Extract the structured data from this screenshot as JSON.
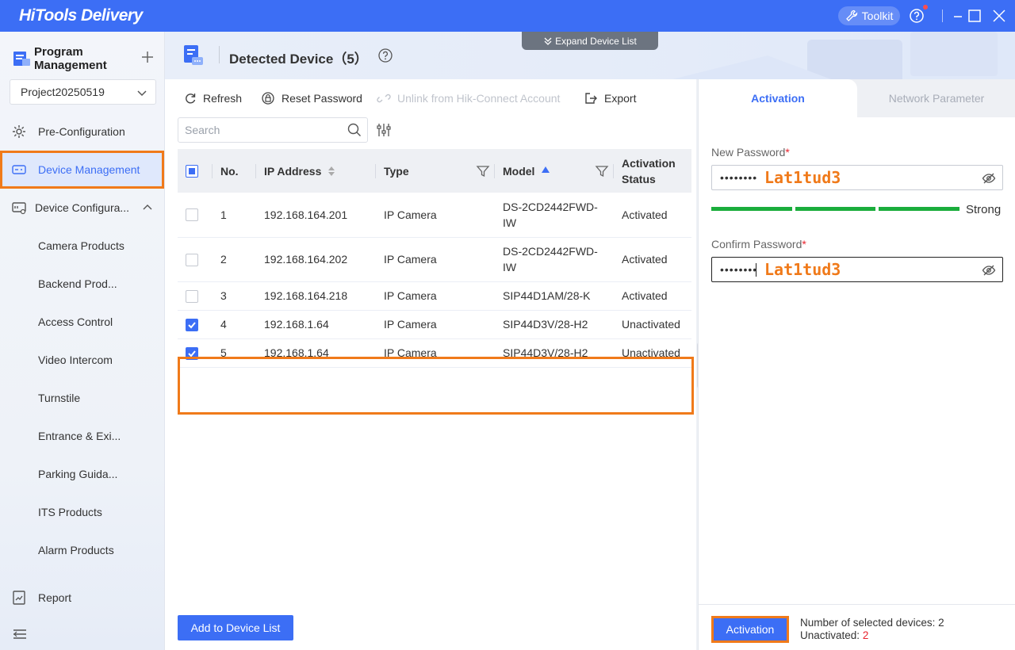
{
  "app": {
    "title": "HiTools Delivery",
    "toolkit_label": "Toolkit"
  },
  "sidebar": {
    "program_title": "Program Management",
    "project": "Project20250519",
    "items": [
      {
        "label": "Pre-Configuration",
        "icon": "gear-icon"
      },
      {
        "label": "Device Management",
        "icon": "device-icon"
      },
      {
        "label": "Device Configura...",
        "icon": "device-config-icon"
      },
      {
        "label": "Camera Products"
      },
      {
        "label": "Backend Prod..."
      },
      {
        "label": "Access Control"
      },
      {
        "label": "Video Intercom"
      },
      {
        "label": "Turnstile"
      },
      {
        "label": "Entrance & Exi..."
      },
      {
        "label": "Parking Guida..."
      },
      {
        "label": "ITS Products"
      },
      {
        "label": "Alarm Products"
      },
      {
        "label": "Report",
        "icon": "report-icon"
      }
    ]
  },
  "header": {
    "expand_label": "Expand Device List",
    "title": "Detected Device（5）"
  },
  "toolbar": {
    "refresh": "Refresh",
    "reset_password": "Reset Password",
    "unlink": "Unlink from Hik-Connect Account",
    "export": "Export",
    "search_placeholder": "Search"
  },
  "table": {
    "headers": {
      "no": "No.",
      "ip": "IP Address",
      "type": "Type",
      "model": "Model",
      "status_line1": "Activation",
      "status_line2": "Status"
    },
    "rows": [
      {
        "no": "1",
        "ip": "192.168.164.201",
        "type": "IP Camera",
        "model_l1": "DS-2CD2442FWD-",
        "model_l2": "IW",
        "status": "Activated",
        "checked": false
      },
      {
        "no": "2",
        "ip": "192.168.164.202",
        "type": "IP Camera",
        "model_l1": "DS-2CD2442FWD-",
        "model_l2": "IW",
        "status": "Activated",
        "checked": false
      },
      {
        "no": "3",
        "ip": "192.168.164.218",
        "type": "IP Camera",
        "model_l1": "SIP44D1AM/28-K",
        "model_l2": "",
        "status": "Activated",
        "checked": false
      },
      {
        "no": "4",
        "ip": "192.168.1.64",
        "type": "IP Camera",
        "model_l1": "SIP44D3V/28-H2",
        "model_l2": "",
        "status": "Unactivated",
        "checked": true
      },
      {
        "no": "5",
        "ip": "192.168.1.64",
        "type": "IP Camera",
        "model_l1": "SIP44D3V/28-H2",
        "model_l2": "",
        "status": "Unactivated",
        "checked": true
      }
    ]
  },
  "add_button": "Add to Device List",
  "activation": {
    "tab_activation": "Activation",
    "tab_network": "Network Parameter",
    "new_password_label": "New Password",
    "confirm_password_label": "Confirm Password",
    "required_mark": "*",
    "password_mask": "••••••••",
    "password_hint": "Lat1tud3",
    "strength": "Strong",
    "button": "Activation",
    "selected_label": "Number of selected devices: 2",
    "unactivated_label": "Unactivated:",
    "unactivated_count": "2"
  },
  "colors": {
    "accent": "#3c6ef5",
    "highlight": "#f07a1a",
    "activated": "#2a9d3a",
    "unactivated": "#e8222d",
    "strength": "#1aad3c"
  }
}
